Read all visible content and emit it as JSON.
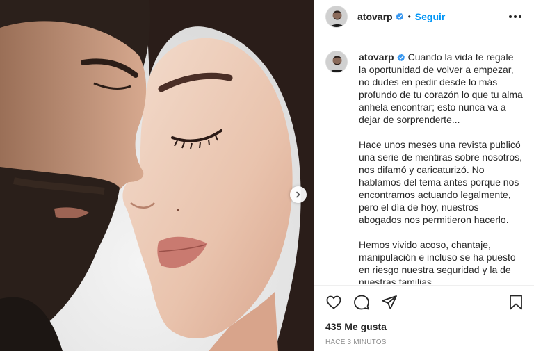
{
  "post": {
    "photo_alt": "",
    "next_icon": "chevron-right-icon"
  },
  "header": {
    "username": "atovarp",
    "separator": "•",
    "follow_label": "Seguir",
    "more_icon": "more-options-icon"
  },
  "caption": {
    "username": "atovarp",
    "paragraphs": [
      "Cuando la vida te regale la oportunidad de volver a empezar, no dudes en pedir desde lo más profundo de tu corazón lo que tu alma anhela encontrar; esto nunca va a dejar de sorprenderte...",
      "Hace unos meses una revista publicó una serie de mentiras sobre nosotros, nos difamó y caricaturizó. No hablamos del tema antes porque nos encontramos actuando legalmente, pero el día de hoy, nuestros abogados nos permitieron hacerlo.",
      "Hemos vivido acoso, chantaje, manipulación e incluso se ha puesto en riesgo nuestra seguridad y la de nuestras familias."
    ]
  },
  "actions": {
    "like_icon": "heart-icon",
    "comment_icon": "comment-icon",
    "share_icon": "share-icon",
    "save_icon": "bookmark-icon"
  },
  "likes_text": "435 Me gusta",
  "timestamp": "HACE 3 MINUTOS",
  "colors": {
    "link_blue": "#0095f6",
    "verified_blue": "#3897f0",
    "text": "#262626",
    "muted": "#8e8e8e",
    "border": "#efefef"
  }
}
